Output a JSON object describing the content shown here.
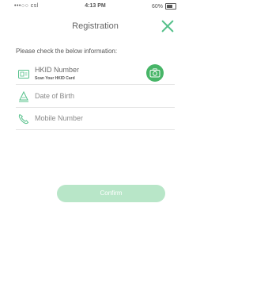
{
  "status_bar": {
    "carrier": "•••○○ csl",
    "time": "4:13 PM",
    "battery": "60%"
  },
  "header": {
    "title": "Registration"
  },
  "instruction": "Please check the below information:",
  "fields": [
    {
      "label": "HKID Number",
      "sublabel": "Scan Your HKID Card"
    },
    {
      "label": "Date of Birth"
    },
    {
      "label": "Mobile Number"
    }
  ],
  "confirm_label": "Confirm",
  "colors": {
    "accent": "#47b567",
    "confirm_disabled": "#b8e6c8"
  },
  "icons": [
    "wifi-icon",
    "battery-icon",
    "close-icon",
    "id-card-icon",
    "camera-icon",
    "calendar-icon",
    "phone-icon"
  ]
}
